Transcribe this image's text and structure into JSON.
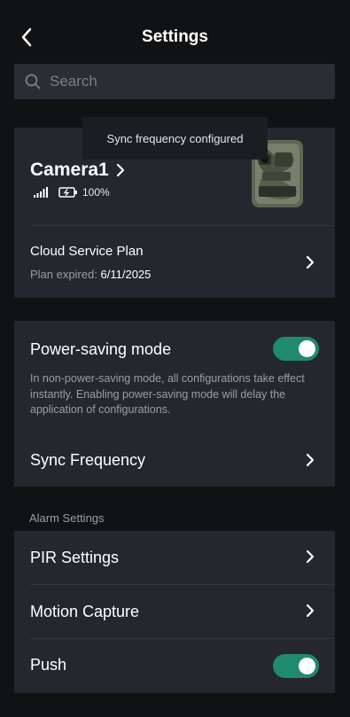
{
  "header": {
    "title": "Settings"
  },
  "search": {
    "placeholder": "Search"
  },
  "toast": {
    "text": "Sync frequency configured"
  },
  "device": {
    "name": "Camera1",
    "battery": "100%",
    "cloud_plan_label": "Cloud Service Plan",
    "plan_expired_label": "Plan expired:",
    "plan_expired_date": "6/11/2025"
  },
  "power": {
    "label": "Power-saving mode",
    "enabled": true,
    "description": "In non-power-saving mode, all configurations take effect instantly. Enabling power-saving mode will delay the application of configurations.",
    "sync_label": "Sync Frequency"
  },
  "alarm": {
    "section_title": "Alarm Settings",
    "pir_label": "PIR Settings",
    "motion_label": "Motion Capture",
    "push_label": "Push",
    "push_enabled": true
  },
  "colors": {
    "accent": "#1f8a6d",
    "card": "#24272e",
    "background": "#111214"
  }
}
